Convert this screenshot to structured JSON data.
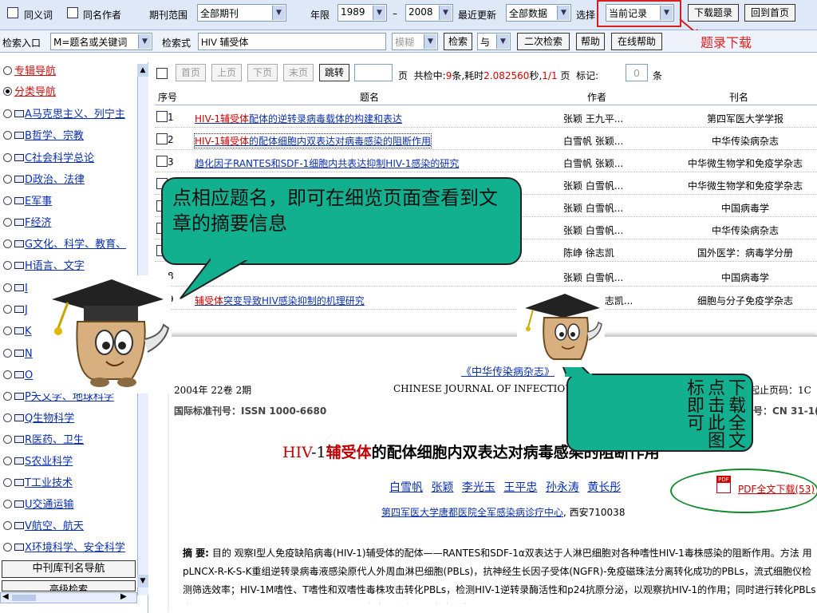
{
  "topbar": {
    "synonym": "同义词",
    "same_author": "同名作者",
    "journal_range_label": "期刊范围",
    "journal_range_value": "全部期刊",
    "year_label": "年限",
    "year_from": "1989",
    "dash": "–",
    "year_to": "2008",
    "update_label": "最近更新",
    "update_value": "全部数据",
    "select_label": "选择",
    "select_value": "当前记录",
    "download_btn": "下载题录",
    "home_btn": "回到首页",
    "download_note": "题录下载"
  },
  "searchbar": {
    "entry_label": "检索入口",
    "entry_value": "M=题名或关键词",
    "expr_label": "检索式",
    "expr_value": "HIV 辅受体",
    "fuzzy": "模糊",
    "search_btn": "检索",
    "and_value": "与",
    "second_search": "二次检索",
    "help": "帮助",
    "online_help": "在线帮助"
  },
  "pager": {
    "first": "首页",
    "prev": "上页",
    "next": "下页",
    "last": "末页",
    "jump": "跳转",
    "page_unit": "页",
    "summary_a": "共检中:",
    "count": "9",
    "summary_b": "条,耗时",
    "time": "2.082560",
    "summary_c": "秒,",
    "page": "1/1",
    "summary_d": "页",
    "mark_label": "标记:",
    "mark_value": "0",
    "mark_unit": "条"
  },
  "table": {
    "headers": [
      "序号",
      "题名",
      "作者",
      "刊名"
    ],
    "rows": [
      {
        "n": "1",
        "hl": "HIV-1辅受体",
        "rest": "配体的逆转录病毒载体的构建和表达",
        "author": "张颖 王九平...",
        "journal": "第四军医大学学报"
      },
      {
        "n": "2",
        "hl": "HIV-1辅受体",
        "rest": "的配体细胞内双表达对病毒感染的阻断作用",
        "author": "白雪帆 张颖...",
        "journal": "中华传染病杂志"
      },
      {
        "n": "3",
        "hl": "",
        "rest": "趋化因子RANTES和SDF-1细胞内共表达抑制HIV-1感染的研究",
        "author": "白雪帆 张颖...",
        "journal": "中华微生物学和免疫学杂志"
      },
      {
        "n": "4",
        "hl": "",
        "rest": "",
        "author": "张颖 白雪帆...",
        "journal": "中华微生物学和免疫学杂志"
      },
      {
        "n": "5",
        "hl": "",
        "rest": "",
        "author": "张颖 白雪帆...",
        "journal": "中国病毒学"
      },
      {
        "n": "6",
        "hl": "",
        "rest": "",
        "author": "张颖 白雪帆...",
        "journal": "中华传染病杂志"
      },
      {
        "n": "7",
        "hl": "",
        "rest": "",
        "author": "陈峥 徐志凯",
        "journal": "国外医学：病毒学分册"
      },
      {
        "n": "8",
        "hl": "",
        "rest": "",
        "author": "张颖 白雪帆...",
        "journal": "中国病毒学"
      },
      {
        "n": "9",
        "hl": "辅受体",
        "rest": "突变导致HIV感染抑制的机理研究",
        "author": "鞠志东 徐志凯...",
        "journal": "细胞与分子免疫学杂志"
      }
    ]
  },
  "sidebar": {
    "items": [
      "专辑导航",
      "分类导航",
      "A马克思主义、列宁主",
      "B哲学、宗教",
      "C社会科学总论",
      "D政治、法律",
      "E军事",
      "F经济",
      "G文化、科学、教育、",
      "H语言、文字",
      "I",
      "J",
      "K",
      "N",
      "O",
      "P天文学、地球科学",
      "Q生物科学",
      "R医药、卫生",
      "S农业科学",
      "T工业技术",
      "U交通运输",
      "V航空、航天",
      "X环境科学、安全科学"
    ],
    "bottom_btn": "中刊库刊名导航",
    "bottom_btn2": "高级检索"
  },
  "callouts": {
    "left": "点相应题名，即可在细览页面查看到文章的摘要信息",
    "right": "下载全文点击此图标即可"
  },
  "article": {
    "journal_link": "《中华传染病杂志》",
    "issue": "2004年 22卷 2期",
    "en_journal": "CHINESE JOURNAL OF INFECTIOUS",
    "start_page": "起止页码：1C",
    "issn": "国际标准刊号：ISSN 1000-6680",
    "cn": "号：CN 31-1(",
    "title_prefix": "HIV",
    "title_dash": "-1",
    "title_hl": "辅受体",
    "title_rest": "的配体细胞内双表达对病毒感染的阻断作用",
    "authors": [
      "白雪帆",
      "张颖",
      "李光玉",
      "王平忠",
      "孙永涛",
      "黄长彤"
    ],
    "affiliation": "第四军医大学唐都医院全军感染病诊疗中心",
    "city": ", 西安710038",
    "pdf": "PDF全文下载(53)",
    "abstract_label": "摘  要:",
    "abstract": "目的 观察Ⅰ型人免疫缺陷病毒(HIV-1)辅受体的配体——RANTES和SDF-1α双表达于人淋巴细胞对各种嗜性HIV-1毒株感染的阻断作用。方法 用pLNCX-R-K-S-K重组逆转录病毒液感染原代人外周血淋巴细胞(PBLs)，抗神经生长因子受体(NGFR)-免疫磁珠法分离转化成功的PBLs，流式细胞仪检测筛选效率；HIV-1M嗜性、T嗜性和双嗜性毒株攻击转化PBLs，检测HIV-1逆转录酶活性和p24抗原分泌，以观察抗HIV-1的作用；同时进行转化PBLs表面CD3、CD4、CCR5、CCR5和CXCR4表达及细胞因子表达测定"
  }
}
